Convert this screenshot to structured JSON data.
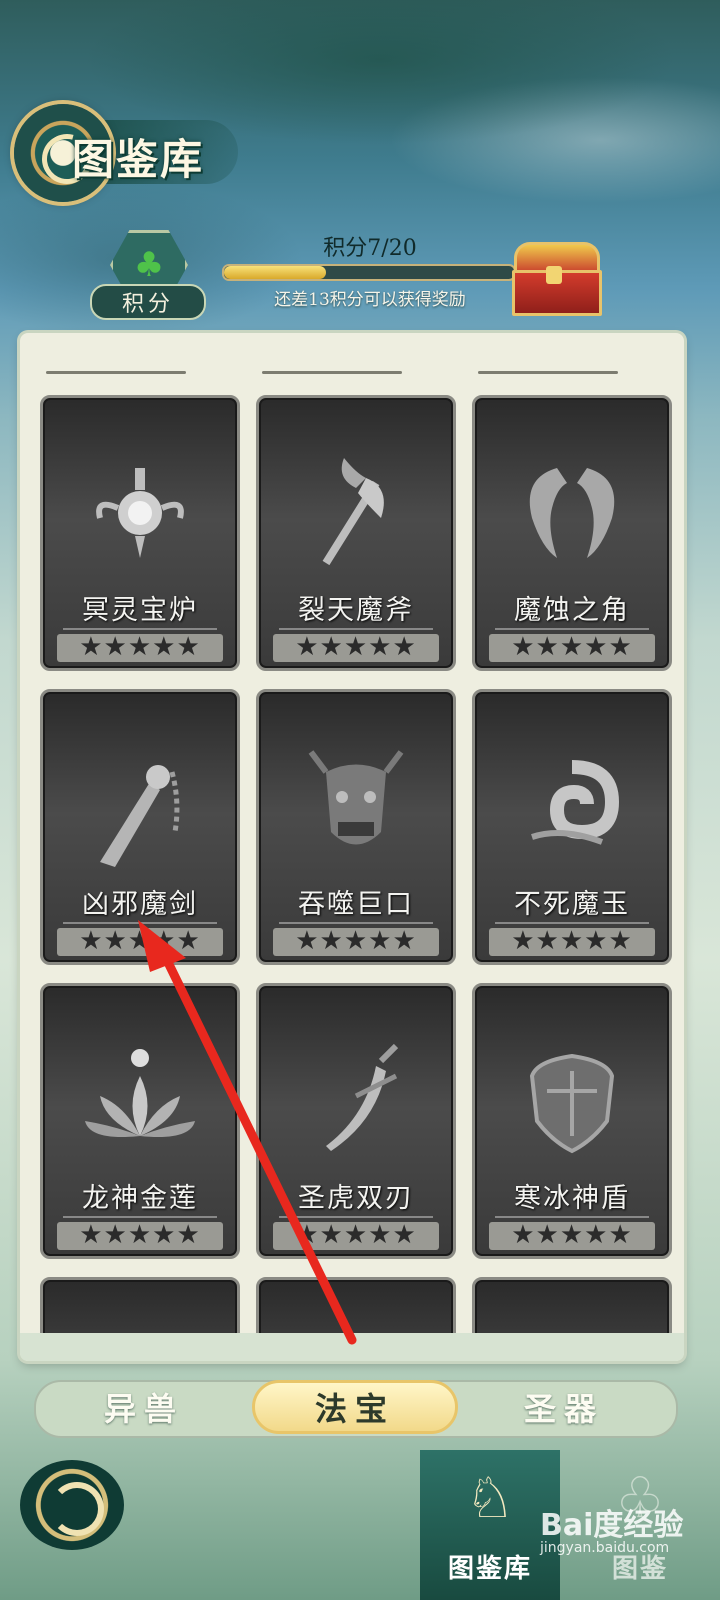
{
  "header": {
    "title": "图鉴库"
  },
  "points": {
    "label": "积分",
    "score_text": "积分7/20",
    "progress_fraction": 0.35,
    "hint": "还差13积分可以获得奖励"
  },
  "cards": [
    {
      "name": "冥灵宝炉",
      "stars": "★★★★★"
    },
    {
      "name": "裂天魔斧",
      "stars": "★★★★★"
    },
    {
      "name": "魔蚀之角",
      "stars": "★★★★★"
    },
    {
      "name": "凶邪魔剑",
      "stars": "★★★★★"
    },
    {
      "name": "吞噬巨口",
      "stars": "★★★★★"
    },
    {
      "name": "不死魔玉",
      "stars": "★★★★★"
    },
    {
      "name": "龙神金莲",
      "stars": "★★★★★"
    },
    {
      "name": "圣虎双刃",
      "stars": "★★★★★"
    },
    {
      "name": "寒冰神盾",
      "stars": "★★★★★"
    }
  ],
  "tabs": [
    {
      "label": "异兽",
      "active": false
    },
    {
      "label": "法宝",
      "active": true
    },
    {
      "label": "圣器",
      "active": false
    }
  ],
  "nav": [
    {
      "label": "图鉴库",
      "icon": "tujianku-icon",
      "active": true
    },
    {
      "label": "图鉴",
      "icon": "tujian-icon",
      "active": false
    }
  ],
  "watermark": {
    "brand": "Bai度经验",
    "sub": "jingyan.baidu.com"
  },
  "colors": {
    "accent_gold": "#e8c569",
    "panel_bg": "#eeeee0",
    "annotation_arrow": "#e8281e"
  }
}
